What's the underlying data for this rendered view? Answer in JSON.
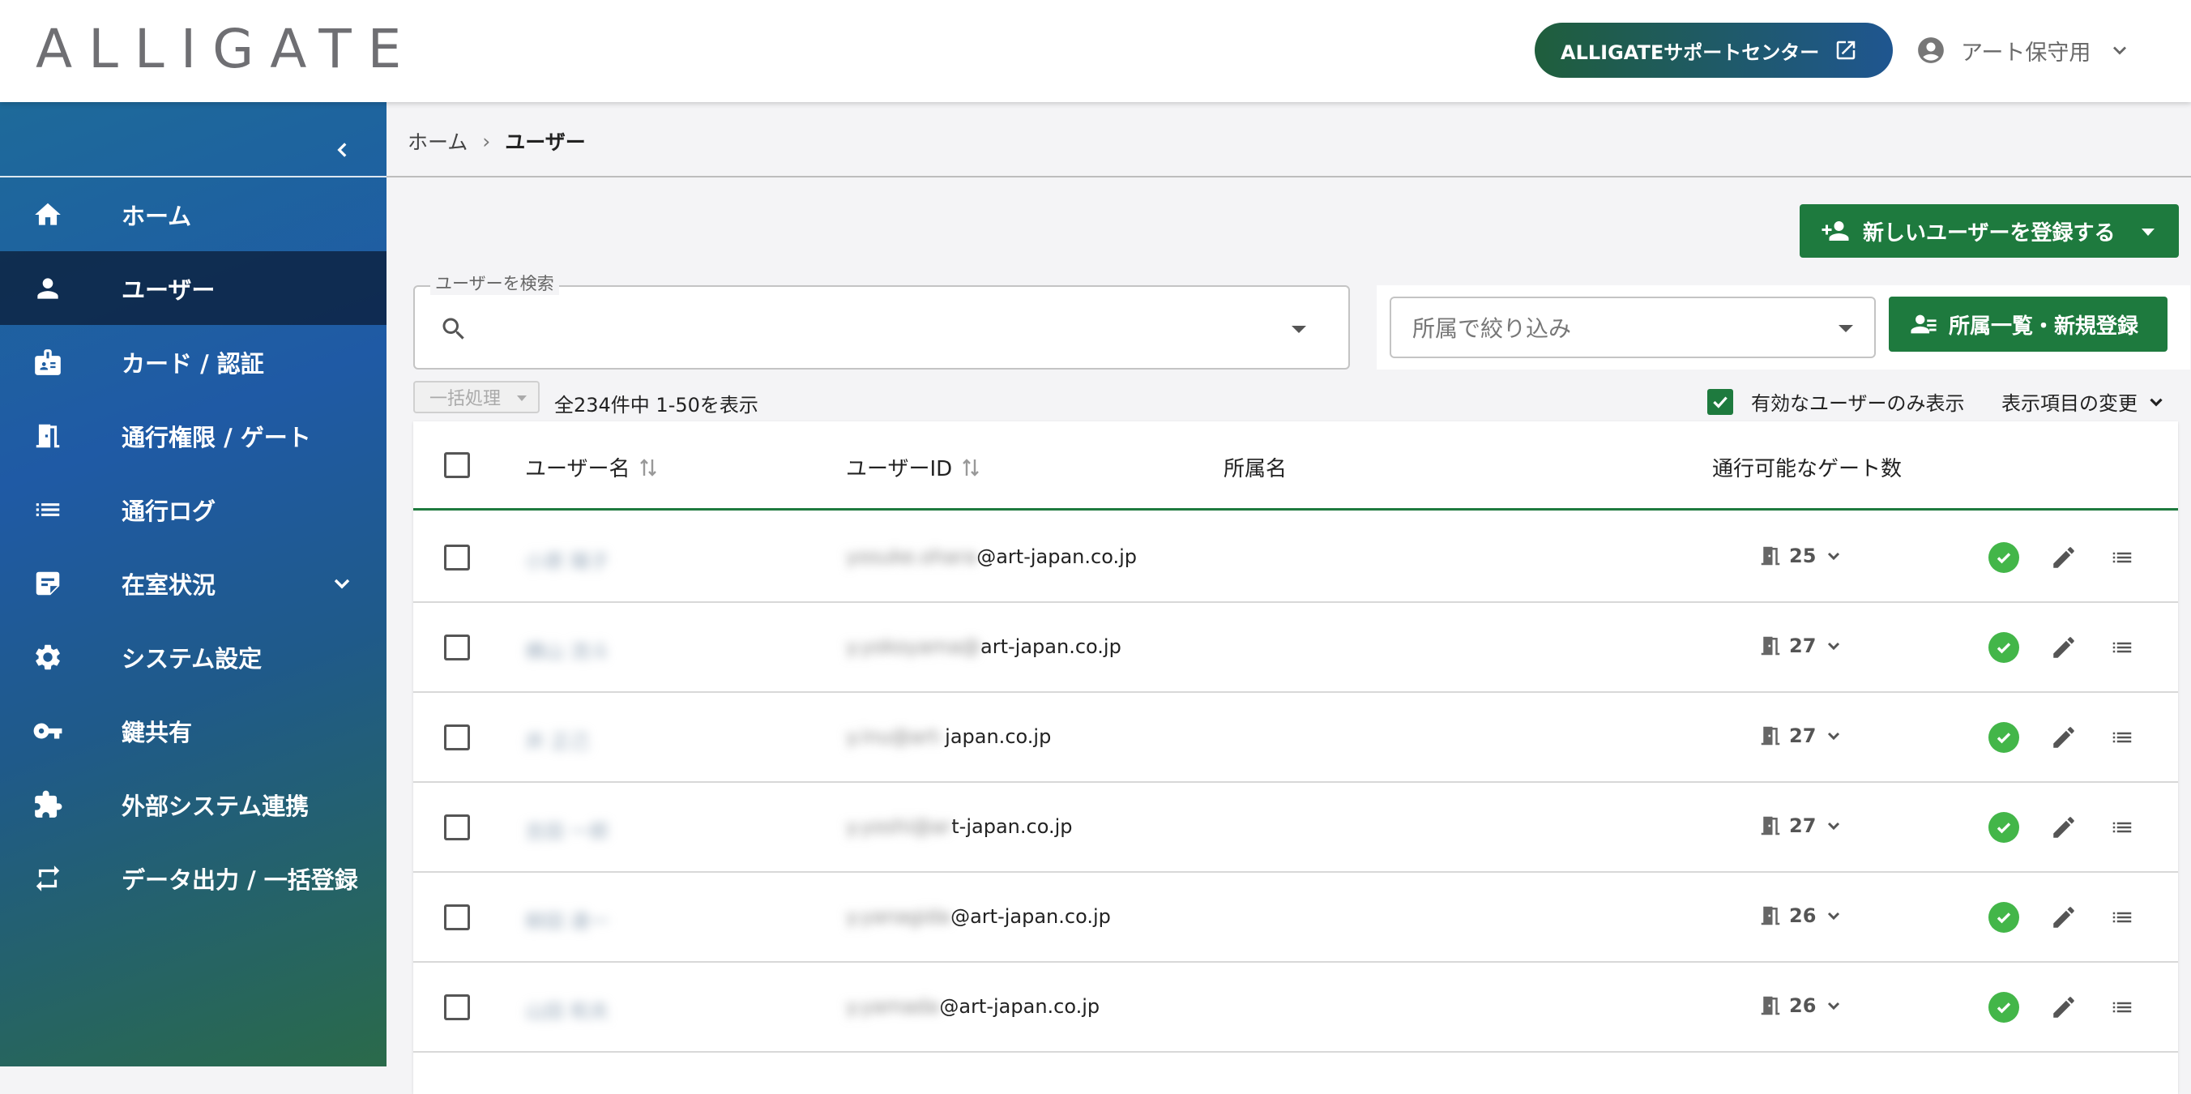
{
  "header": {
    "logo": "ALLIGATE",
    "support_button": "ALLIGATEサポートセンター",
    "user_name": "アート保守用"
  },
  "sidebar": {
    "items": [
      {
        "label": "ホーム",
        "icon": "home-icon"
      },
      {
        "label": "ユーザー",
        "icon": "person-icon",
        "active": true
      },
      {
        "label": "カード / 認証",
        "icon": "badge-icon"
      },
      {
        "label": "通行権限 / ゲート",
        "icon": "door-icon"
      },
      {
        "label": "通行ログ",
        "icon": "list-icon"
      },
      {
        "label": "在室状況",
        "icon": "assignment-icon",
        "expandable": true
      },
      {
        "label": "システム設定",
        "icon": "gear-icon"
      },
      {
        "label": "鍵共有",
        "icon": "key-icon"
      },
      {
        "label": "外部システム連携",
        "icon": "puzzle-icon"
      },
      {
        "label": "データ出力 / 一括登録",
        "icon": "swap-icon"
      }
    ]
  },
  "breadcrumb": {
    "home": "ホーム",
    "separator": "›",
    "current": "ユーザー"
  },
  "toolbar": {
    "new_user_button": "新しいユーザーを登録する",
    "search_label": "ユーザーを検索",
    "search_value": "",
    "filter_placeholder": "所属で絞り込み",
    "dept_button": "所属一覧・新規登録",
    "bulk_button": "一括処理",
    "count_text": "全234件中 1-50を表示",
    "active_only_label": "有効なユーザーのみ表示",
    "active_only_checked": true,
    "column_change": "表示項目の変更"
  },
  "table": {
    "headers": {
      "user_name": "ユーザー名",
      "user_id": "ユーザーID",
      "department": "所属名",
      "gates": "通行可能なゲート数"
    },
    "rows": [
      {
        "name": "小原 陽子",
        "id_masked": "yosuke.ohara",
        "id_visible": "@art-japan.co.jp",
        "department": "",
        "gates": "25",
        "status": "active"
      },
      {
        "name": "横山 流斗",
        "id_masked": "y.yokoyama@",
        "id_visible": "art-japan.co.jp",
        "department": "",
        "gates": "27",
        "status": "active"
      },
      {
        "name": "井 正己",
        "id_masked": "y.inu@art-",
        "id_visible": "japan.co.jp",
        "department": "",
        "gates": "27",
        "status": "active"
      },
      {
        "name": "吉田 一郎",
        "id_masked": "y.yoshi@ar",
        "id_visible": "t-japan.co.jp",
        "department": "",
        "gates": "27",
        "status": "active"
      },
      {
        "name": "柳田 達一",
        "id_masked": "y.yanagida",
        "id_visible": "@art-japan.co.jp",
        "department": "",
        "gates": "26",
        "status": "active"
      },
      {
        "name": "山田 和夫",
        "id_masked": "y.yamada",
        "id_visible": "@art-japan.co.jp",
        "department": "",
        "gates": "26",
        "status": "active"
      }
    ]
  },
  "colors": {
    "primary_green": "#1e7a3e",
    "status_green": "#43b649",
    "sidebar_blue": "#1f5aa5"
  }
}
